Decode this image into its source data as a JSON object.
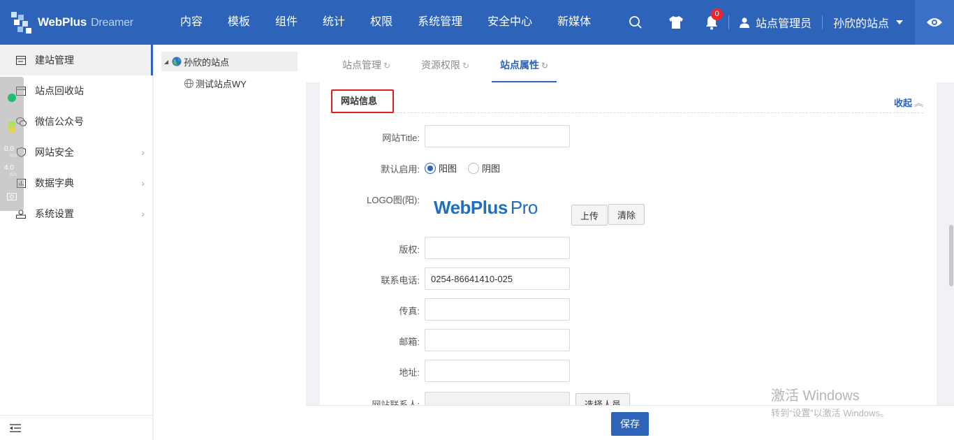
{
  "brand": {
    "name": "WebPlus",
    "sub": "Dreamer"
  },
  "nav": [
    "内容",
    "模板",
    "组件",
    "统计",
    "权限",
    "系统管理",
    "安全中心",
    "新媒体"
  ],
  "header": {
    "notification_count": "0",
    "user_name": "站点管理员",
    "site_name": "孙欣的站点"
  },
  "sidebar": {
    "items": [
      {
        "label": "建站管理"
      },
      {
        "label": "站点回收站"
      },
      {
        "label": "微信公众号"
      },
      {
        "label": "网站安全"
      },
      {
        "label": "数据字典"
      },
      {
        "label": "系统设置"
      }
    ]
  },
  "widget": {
    "up_value": "0.0",
    "up_unit": "K/s",
    "down_value": "4.0",
    "down_unit": "K/s"
  },
  "tree": {
    "root": "孙欣的站点",
    "child": "测试站点WY"
  },
  "tabs": [
    "站点管理",
    "资源权限",
    "站点属性"
  ],
  "section": {
    "title": "网站信息",
    "collapse_label": "收起"
  },
  "form": {
    "title_label": "网站Title:",
    "title_value": "",
    "default_label": "默认启用:",
    "radio_positive": "阳图",
    "radio_negative": "阴图",
    "logo_label": "LOGO图(阳):",
    "logo_text": "WebPlus",
    "logo_pro": "Pro",
    "upload_btn": "上传",
    "clear_btn": "清除",
    "copyright_label": "版权:",
    "copyright_value": "",
    "phone_label": "联系电话:",
    "phone_value": "0254-86641410-025",
    "fax_label": "传真:",
    "fax_value": "",
    "email_label": "邮箱:",
    "email_value": "",
    "address_label": "地址:",
    "address_value": "",
    "contact_label": "网站联系人:",
    "contact_value": "",
    "select_person_btn": "选择人员"
  },
  "footer": {
    "save_label": "保存"
  },
  "watermark": {
    "line1": "激活 Windows",
    "line2": "转到“设置”以激活 Windows。"
  },
  "colors": {
    "primary": "#2d63b8",
    "highlight": "#e02020"
  }
}
